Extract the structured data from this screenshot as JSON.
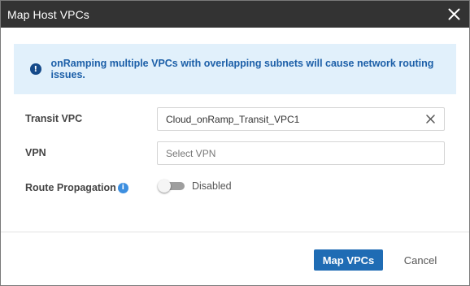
{
  "dialog": {
    "title": "Map Host VPCs",
    "close_icon": "close-icon"
  },
  "banner": {
    "icon": "info-icon",
    "icon_glyph": "!",
    "message": "onRamping multiple VPCs with overlapping subnets will cause network routing issues."
  },
  "form": {
    "transit_vpc": {
      "label": "Transit VPC",
      "value": "Cloud_onRamp_Transit_VPC1",
      "clear_icon": "clear-icon"
    },
    "vpn": {
      "label": "VPN",
      "placeholder": "Select VPN"
    },
    "route_propagation": {
      "label": "Route Propagation",
      "help_icon_glyph": "i",
      "toggle_state": "Disabled",
      "enabled": false
    }
  },
  "footer": {
    "primary_label": "Map VPCs",
    "cancel_label": "Cancel"
  },
  "colors": {
    "titlebar": "#333333",
    "banner_bg": "#e1f0fb",
    "banner_text": "#1c5fa8",
    "primary_button": "#1f6cb4"
  }
}
